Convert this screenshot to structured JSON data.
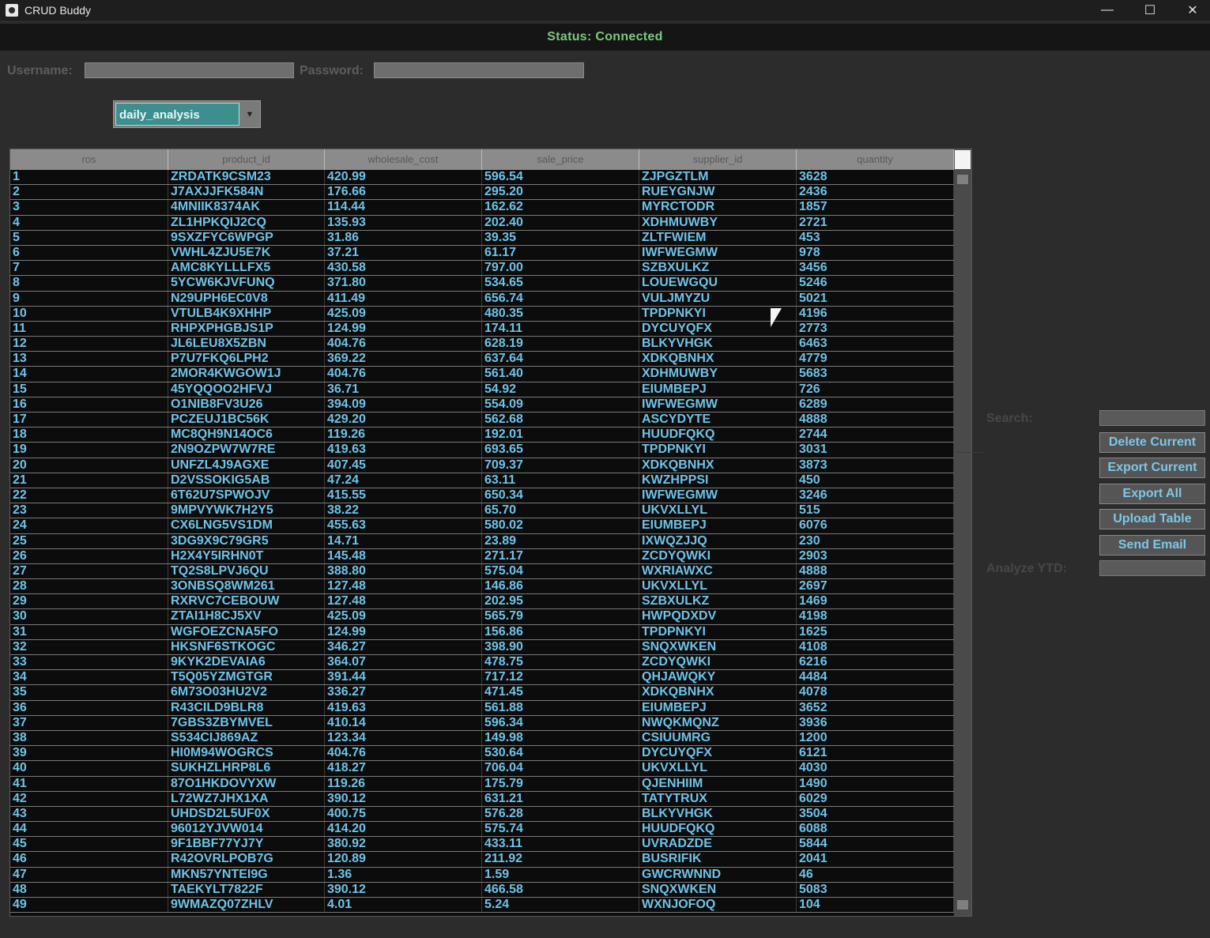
{
  "window": {
    "title": "CRUD Buddy",
    "minimize_glyph": "—",
    "maximize_glyph": "☐",
    "close_glyph": "✕"
  },
  "status": "Status: Connected",
  "login": {
    "username_label": "Username:",
    "password_label": "Password:",
    "username_value": "",
    "password_value": ""
  },
  "table_select": {
    "selected": "daily_analysis"
  },
  "table": {
    "columns": [
      "ros",
      "product_id",
      "wholesale_cost",
      "sale_price",
      "supplier_id",
      "quantity"
    ],
    "rows": [
      [
        "1",
        "ZRDATK9CSM23",
        "420.99",
        "596.54",
        "ZJPGZTLM",
        "3628"
      ],
      [
        "2",
        "J7AXJJFK584N",
        "176.66",
        "295.20",
        "RUEYGNJW",
        "2436"
      ],
      [
        "3",
        "4MNIIK8374AK",
        "114.44",
        "162.62",
        "MYRCTODR",
        "1857"
      ],
      [
        "4",
        "ZL1HPKQIJ2CQ",
        "135.93",
        "202.40",
        "XDHMUWBY",
        "2721"
      ],
      [
        "5",
        "9SXZFYC6WPGP",
        "31.86",
        "39.35",
        "ZLTFWIEM",
        "453"
      ],
      [
        "6",
        "VWHL4ZJU5E7K",
        "37.21",
        "61.17",
        "IWFWEGMW",
        "978"
      ],
      [
        "7",
        "AMC8KYLLLFX5",
        "430.58",
        "797.00",
        "SZBXULKZ",
        "3456"
      ],
      [
        "8",
        "5YCW6KJVFUNQ",
        "371.80",
        "534.65",
        "LOUEWGQU",
        "5246"
      ],
      [
        "9",
        "N29UPH6EC0V8",
        "411.49",
        "656.74",
        "VULJMYZU",
        "5021"
      ],
      [
        "10",
        "VTULB4K9XHHP",
        "425.09",
        "480.35",
        "TPDPNKYI",
        "4196"
      ],
      [
        "11",
        "RHPXPHGBJS1P",
        "124.99",
        "174.11",
        "DYCUYQFX",
        "2773"
      ],
      [
        "12",
        "JL6LEU8X5ZBN",
        "404.76",
        "628.19",
        "BLKYVHGK",
        "6463"
      ],
      [
        "13",
        "P7U7FKQ6LPH2",
        "369.22",
        "637.64",
        "XDKQBNHX",
        "4779"
      ],
      [
        "14",
        "2MOR4KWGOW1J",
        "404.76",
        "561.40",
        "XDHMUWBY",
        "5683"
      ],
      [
        "15",
        "45YQQOO2HFVJ",
        "36.71",
        "54.92",
        "EIUMBEPJ",
        "726"
      ],
      [
        "16",
        "O1NIB8FV3U26",
        "394.09",
        "554.09",
        "IWFWEGMW",
        "6289"
      ],
      [
        "17",
        "PCZEUJ1BC56K",
        "429.20",
        "562.68",
        "ASCYDYTE",
        "4888"
      ],
      [
        "18",
        "MC8QH9N14OC6",
        "119.26",
        "192.01",
        "HUUDFQKQ",
        "2744"
      ],
      [
        "19",
        "2N9OZPW7W7RE",
        "419.63",
        "693.65",
        "TPDPNKYI",
        "3031"
      ],
      [
        "20",
        "UNFZL4J9AGXE",
        "407.45",
        "709.37",
        "XDKQBNHX",
        "3873"
      ],
      [
        "21",
        "D2VSSOKIG5AB",
        "47.24",
        "63.11",
        "KWZHPPSI",
        "450"
      ],
      [
        "22",
        "6T62U7SPWOJV",
        "415.55",
        "650.34",
        "IWFWEGMW",
        "3246"
      ],
      [
        "23",
        "9MPVYWK7H2Y5",
        "38.22",
        "65.70",
        "UKVXLLYL",
        "515"
      ],
      [
        "24",
        "CX6LNG5VS1DM",
        "455.63",
        "580.02",
        "EIUMBEPJ",
        "6076"
      ],
      [
        "25",
        "3DG9X9C79GR5",
        "14.71",
        "23.89",
        "IXWQZJJQ",
        "230"
      ],
      [
        "26",
        "H2X4Y5IRHN0T",
        "145.48",
        "271.17",
        "ZCDYQWKI",
        "2903"
      ],
      [
        "27",
        "TQ2S8LPVJ6QU",
        "388.80",
        "575.04",
        "WXRIAWXC",
        "4888"
      ],
      [
        "28",
        "3ONBSQ8WM261",
        "127.48",
        "146.86",
        "UKVXLLYL",
        "2697"
      ],
      [
        "29",
        "RXRVC7CEBOUW",
        "127.48",
        "202.95",
        "SZBXULKZ",
        "1469"
      ],
      [
        "30",
        "ZTAI1H8CJ5XV",
        "425.09",
        "565.79",
        "HWPQDXDV",
        "4198"
      ],
      [
        "31",
        "WGFOEZCNA5FO",
        "124.99",
        "156.86",
        "TPDPNKYI",
        "1625"
      ],
      [
        "32",
        "HKSNF6STKOGC",
        "346.27",
        "398.90",
        "SNQXWKEN",
        "4108"
      ],
      [
        "33",
        "9KYK2DEVAIA6",
        "364.07",
        "478.75",
        "ZCDYQWKI",
        "6216"
      ],
      [
        "34",
        "T5Q05YZMGTGR",
        "391.44",
        "717.12",
        "QHJAWQKY",
        "4484"
      ],
      [
        "35",
        "6M73O03HU2V2",
        "336.27",
        "471.45",
        "XDKQBNHX",
        "4078"
      ],
      [
        "36",
        "R43CILD9BLR8",
        "419.63",
        "561.88",
        "EIUMBEPJ",
        "3652"
      ],
      [
        "37",
        "7GBS3ZBYMVEL",
        "410.14",
        "596.34",
        "NWQKMQNZ",
        "3936"
      ],
      [
        "38",
        "S534CIJ869AZ",
        "123.34",
        "149.98",
        "CSIUUMRG",
        "1200"
      ],
      [
        "39",
        "HI0M94WOGRCS",
        "404.76",
        "530.64",
        "DYCUYQFX",
        "6121"
      ],
      [
        "40",
        "SUKHZLHRP8L6",
        "418.27",
        "706.04",
        "UKVXLLYL",
        "4030"
      ],
      [
        "41",
        "87O1HKDOVYXW",
        "119.26",
        "175.79",
        "QJENHIIM",
        "1490"
      ],
      [
        "42",
        "L72WZ7JHX1XA",
        "390.12",
        "631.21",
        "TATYTRUX",
        "6029"
      ],
      [
        "43",
        "UHDSD2L5UF0X",
        "400.75",
        "576.28",
        "BLKYVHGK",
        "3504"
      ],
      [
        "44",
        "96012YJVW014",
        "414.20",
        "575.74",
        "HUUDFQKQ",
        "6088"
      ],
      [
        "45",
        "9F1BBF77YJ7Y",
        "380.92",
        "433.11",
        "UVRADZDE",
        "5844"
      ],
      [
        "46",
        "R42OVRLPOB7G",
        "120.89",
        "211.92",
        "BUSRIFIK",
        "2041"
      ],
      [
        "47",
        "MKN57YNTEI9G",
        "1.36",
        "1.59",
        "GWCRWNND",
        "46"
      ],
      [
        "48",
        "TAEKYLT7822F",
        "390.12",
        "466.58",
        "SNQXWKEN",
        "5083"
      ],
      [
        "49",
        "9WMAZQ07ZHLV",
        "4.01",
        "5.24",
        "WXNJOFOQ",
        "104"
      ]
    ]
  },
  "sidebar": {
    "search_label": "Search:",
    "search_value": "",
    "buttons": [
      "Delete Current",
      "Export Current",
      "Export All",
      "Upload Table",
      "Send Email"
    ],
    "analyze_label": "Analyze YTD:",
    "analyze_value": ""
  },
  "icons": {
    "app": "crud-buddy-app-icon",
    "dropdown": "chevron-down-icon",
    "cursor": "mouse-pointer-icon"
  },
  "colors": {
    "status_text": "#7ec87e",
    "cell_text": "#6fc3e8",
    "button_text": "#7cc8e8",
    "combo_bg": "#3d8f8f"
  }
}
